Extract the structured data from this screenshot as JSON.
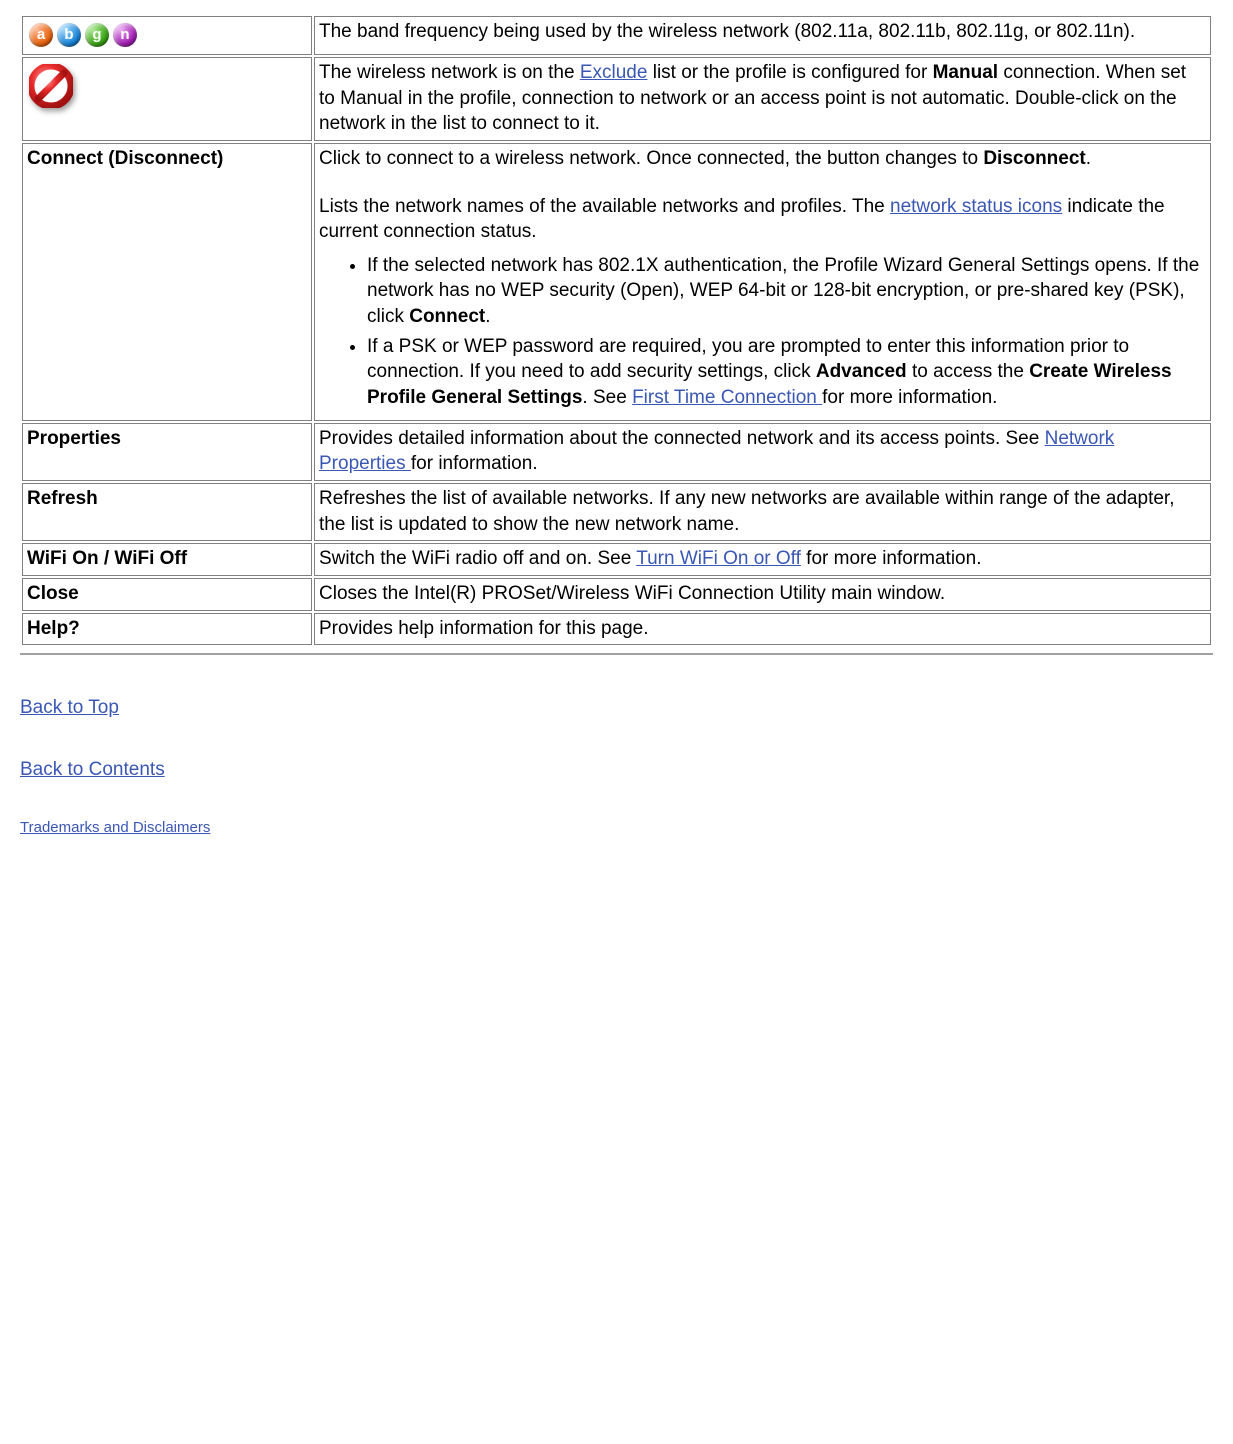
{
  "rows": {
    "band": {
      "letters": {
        "a": "a",
        "b": "b",
        "g": "g",
        "n": "n"
      },
      "desc": "The band frequency being used by the wireless network (802.11a, 802.11b, 802.11g, or 802.11n)."
    },
    "exclude": {
      "p1": "The wireless network is on the ",
      "link": "Exclude",
      "p2": " list or the profile is configured for ",
      "bold": "Manual",
      "p3": " connection. When set to Manual in the profile, connection to network or an access point is not automatic. Double-click on the network in the list to connect to it."
    },
    "connect": {
      "label": "Connect (Disconnect)",
      "p1a": "Click to connect to a wireless network. Once connected, the button changes to ",
      "p1b": "Disconnect",
      "p1c": ".",
      "p2a": "Lists the network names of the available networks and profiles. The ",
      "p2link": "network status icons",
      "p2b": " indicate the current connection status.",
      "li1a": "If the selected network has 802.1X authentication, the Profile Wizard General Settings opens. If the network has no WEP security (Open), WEP 64-bit or 128-bit encryption, or pre-shared key (PSK), click ",
      "li1b": "Connect",
      "li1c": ".",
      "li2a": "If a PSK or WEP password are required, you are prompted to enter this information prior to connection. If you need to add security settings, click ",
      "li2b": "Advanced",
      "li2c": " to access the ",
      "li2d": "Create Wireless Profile General Settings",
      "li2e": ". See ",
      "li2link": "First Time Connection ",
      "li2f": "for more information."
    },
    "properties": {
      "label": "Properties",
      "a": "Provides detailed information about the connected network and its access points. See ",
      "link": "Network Properties ",
      "b": "for information."
    },
    "refresh": {
      "label": "Refresh",
      "desc": "Refreshes the list of available networks. If any new networks are available within range of the adapter, the list is updated to show the new network name."
    },
    "wifi": {
      "label": "WiFi On / WiFi Off",
      "a": "Switch the WiFi radio off and on. See ",
      "link": "Turn WiFi On or Off",
      "b": " for more information."
    },
    "close": {
      "label": "Close",
      "desc": "Closes the Intel(R) PROSet/Wireless WiFi Connection Utility main window."
    },
    "help": {
      "label": "Help?",
      "desc": "Provides help information for this page."
    }
  },
  "links": {
    "back_top": "Back to Top",
    "back_contents": "Back to Contents",
    "trademarks": "Trademarks and Disclaimers"
  }
}
